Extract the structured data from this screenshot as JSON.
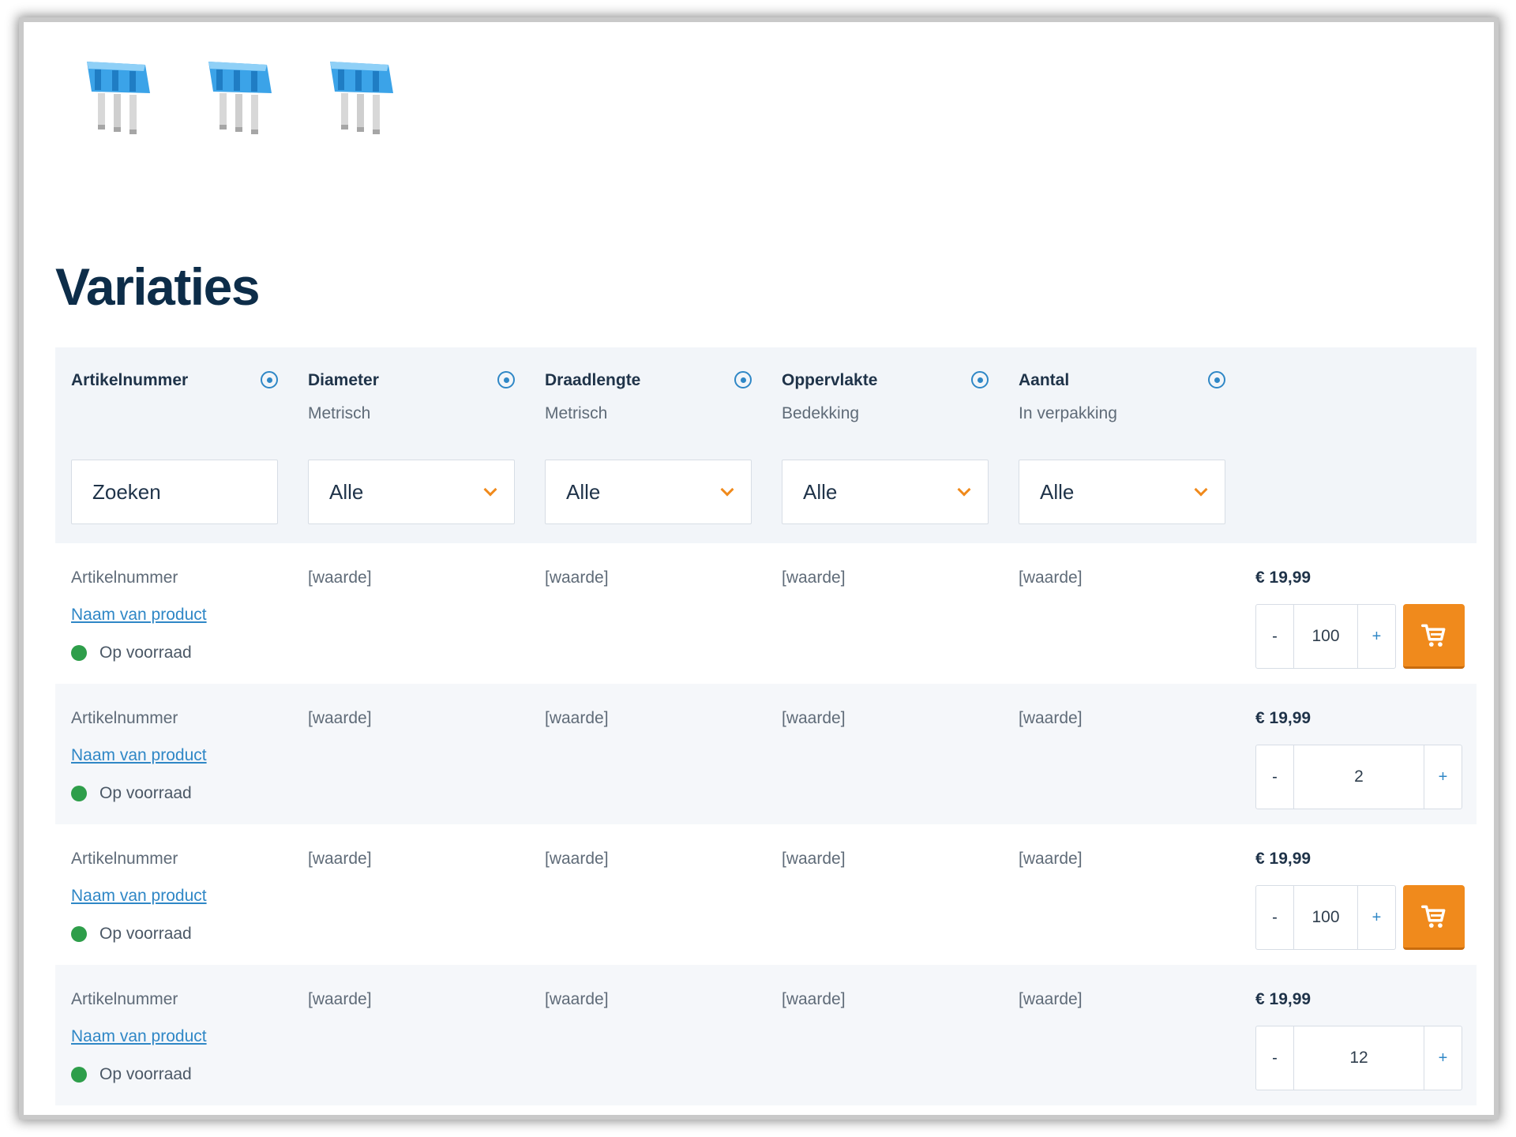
{
  "thumbnails": [
    {
      "icon": "blade-fuse-icon"
    },
    {
      "icon": "blade-fuse-icon"
    },
    {
      "icon": "blade-fuse-icon"
    }
  ],
  "page": {
    "title": "Variaties"
  },
  "table": {
    "columns": [
      {
        "label": "Artikelnummer",
        "sub": "",
        "filter_placeholder": "Zoeken",
        "filter_type": "search"
      },
      {
        "label": "Diameter",
        "sub": "Metrisch",
        "filter_value": "Alle",
        "filter_type": "select"
      },
      {
        "label": "Draadlengte",
        "sub": "Metrisch",
        "filter_value": "Alle",
        "filter_type": "select"
      },
      {
        "label": "Oppervlakte",
        "sub": "Bedekking",
        "filter_value": "Alle",
        "filter_type": "select"
      },
      {
        "label": "Aantal",
        "sub": "In verpakking",
        "filter_value": "Alle",
        "filter_type": "select"
      }
    ],
    "rows": [
      {
        "artikel": "Artikelnummer",
        "product": "Naam van product",
        "stock": "Op voorraad",
        "values": [
          "[waarde]",
          "[waarde]",
          "[waarde]",
          "[waarde]"
        ],
        "price": "€ 19,99",
        "qty": "100",
        "minus": "-",
        "plus": "+",
        "cart": true
      },
      {
        "artikel": "Artikelnummer",
        "product": "Naam van product",
        "stock": "Op voorraad",
        "values": [
          "[waarde]",
          "[waarde]",
          "[waarde]",
          "[waarde]"
        ],
        "price": "€ 19,99",
        "qty": "2",
        "minus": "-",
        "plus": "+",
        "cart": false
      },
      {
        "artikel": "Artikelnummer",
        "product": "Naam van product",
        "stock": "Op voorraad",
        "values": [
          "[waarde]",
          "[waarde]",
          "[waarde]",
          "[waarde]"
        ],
        "price": "€ 19,99",
        "qty": "100",
        "minus": "-",
        "plus": "+",
        "cart": true
      },
      {
        "artikel": "Artikelnummer",
        "product": "Naam van product",
        "stock": "Op voorraad",
        "values": [
          "[waarde]",
          "[waarde]",
          "[waarde]",
          "[waarde]"
        ],
        "price": "€ 19,99",
        "qty": "12",
        "minus": "-",
        "plus": "+",
        "cart": false
      }
    ]
  },
  "colors": {
    "accent": "#2f87c6",
    "cart_button": "#f08a1c",
    "in_stock": "#2e9e4a",
    "title": "#0d2d49"
  }
}
